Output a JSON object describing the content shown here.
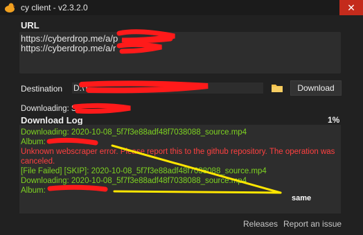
{
  "window": {
    "title": "cy client - v2.3.2.0",
    "close_glyph": "✕"
  },
  "url_section": {
    "label": "URL",
    "lines": [
      "https://cyberdrop.me/a/p",
      "https://cyberdrop.me/a/r"
    ]
  },
  "destination": {
    "label": "Destination",
    "value": "D:\\T",
    "folder_icon": "folder-icon",
    "download_label": "Download"
  },
  "status": {
    "downloading_text": "Downloading: S"
  },
  "log": {
    "label": "Download Log",
    "percent": "1%",
    "lines": [
      "Downloading: 2020-10-08_5f7f3e88adf48f7038088_source.mp4",
      "Album:",
      "Unknown webscraper error. Please report this to the github repository. The operation was canceled.",
      "[File Failed] [SKIP]: 2020-10-08_5f7f3e88adf48f7038088_source.mp4",
      "Downloading: 2020-10-08_5f7f3e88adf48f7038088_source.mp4",
      "Album:"
    ]
  },
  "annotation": {
    "text": "same"
  },
  "footer": {
    "releases": "Releases",
    "report": "Report an issue"
  },
  "colors": {
    "log_green": "#7ed321",
    "log_red": "#ff4040",
    "redaction": "#ff1a1a",
    "marker": "#ffe600"
  }
}
